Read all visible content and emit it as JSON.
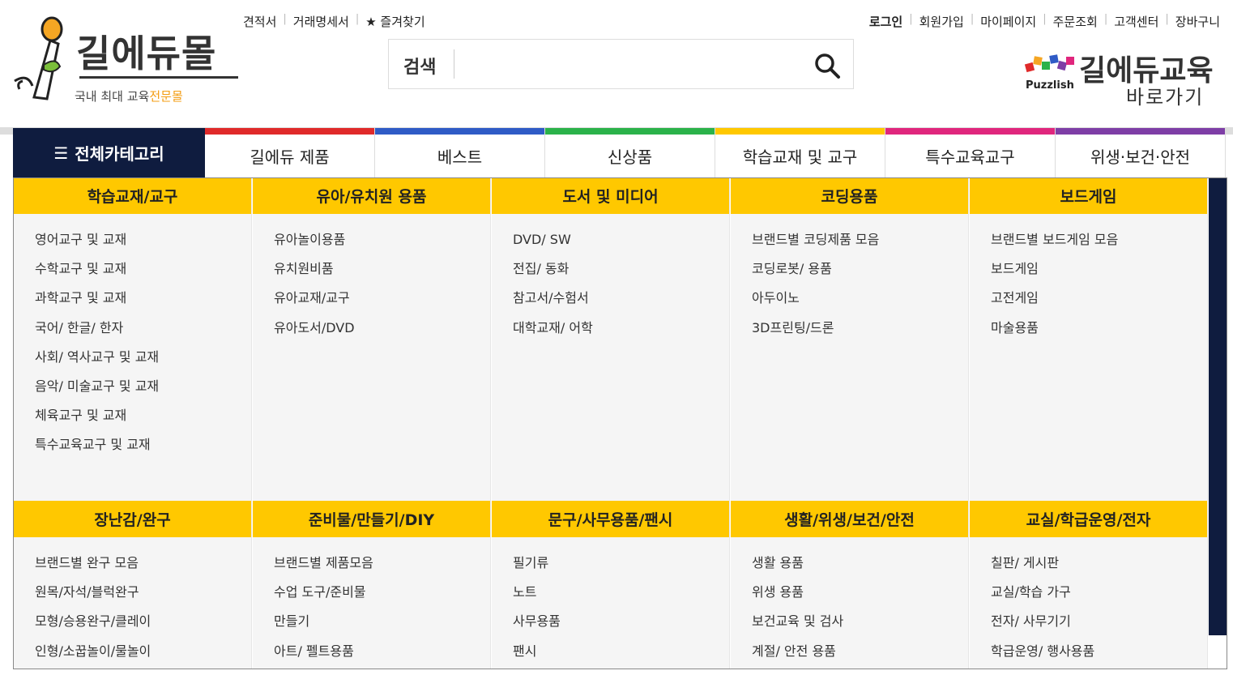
{
  "logo": {
    "title": "길에듀몰",
    "subtitle_main": "국내 최대 교육",
    "subtitle_highlight": "전문몰"
  },
  "top_left_links": [
    "견적서",
    "거래명세서",
    "★ 즐겨찾기"
  ],
  "top_right_links": [
    "로그인",
    "회원가입",
    "마이페이지",
    "주문조회",
    "고객센터",
    "장바구니"
  ],
  "search": {
    "label": "검색",
    "value": "",
    "placeholder": ""
  },
  "puzzlish": {
    "brand": "Puzzlish",
    "title": "길에듀교육",
    "go": "바로가기"
  },
  "nav": {
    "all_label": "전체카테고리",
    "tabs": [
      {
        "label": "길에듀 제품",
        "color": "#e02a2a"
      },
      {
        "label": "베스트",
        "color": "#2f5bc6"
      },
      {
        "label": "신상품",
        "color": "#2bb24a"
      },
      {
        "label": "학습교재 및 교구",
        "color": "#ffc800"
      },
      {
        "label": "특수교육교구",
        "color": "#e0267d"
      },
      {
        "label": "위생·보건·안전",
        "color": "#7e3ea6"
      }
    ]
  },
  "mega_menu": {
    "row1": [
      {
        "title": "학습교재/교구",
        "items": [
          "영어교구 및 교재",
          "수학교구 및 교재",
          "과학교구 및 교재",
          "국어/ 한글/ 한자",
          "사회/ 역사교구 및 교재",
          "음악/ 미술교구 및 교재",
          "체육교구 및 교재",
          "특수교육교구 및 교재"
        ]
      },
      {
        "title": "유아/유치원 용품",
        "items": [
          "유아놀이용품",
          "유치원비품",
          "유아교재/교구",
          "유아도서/DVD"
        ]
      },
      {
        "title": "도서 및 미디어",
        "items": [
          "DVD/ SW",
          "전집/ 동화",
          "참고서/수험서",
          "대학교재/ 어학"
        ]
      },
      {
        "title": "코딩용품",
        "items": [
          "브랜드별 코딩제품 모음",
          "코딩로봇/ 용품",
          "아두이노",
          "3D프린팅/드론"
        ]
      },
      {
        "title": "보드게임",
        "items": [
          "브랜드별 보드게임 모음",
          "보드게임",
          "고전게임",
          "마술용품"
        ]
      }
    ],
    "row2": [
      {
        "title": "장난감/완구",
        "items": [
          "브랜드별 완구 모음",
          "원목/자석/블럭완구",
          "모형/승용완구/클레이",
          "인형/소꿉놀이/물놀이"
        ]
      },
      {
        "title": "준비물/만들기/DIY",
        "items": [
          "브랜드별 제품모음",
          "수업 도구/준비물",
          "만들기",
          "아트/ 펠트용품"
        ]
      },
      {
        "title": "문구/사무용품/팬시",
        "items": [
          "필기류",
          "노트",
          "사무용품",
          "팬시"
        ]
      },
      {
        "title": "생활/위생/보건/안전",
        "items": [
          "생활 용품",
          "위생 용품",
          "보건교육 및 검사",
          "계절/ 안전 용품"
        ]
      },
      {
        "title": "교실/학급운영/전자",
        "items": [
          "칠판/ 게시판",
          "교실/학습 가구",
          "전자/ 사무기기",
          "학급운영/ 행사용품"
        ]
      }
    ]
  }
}
